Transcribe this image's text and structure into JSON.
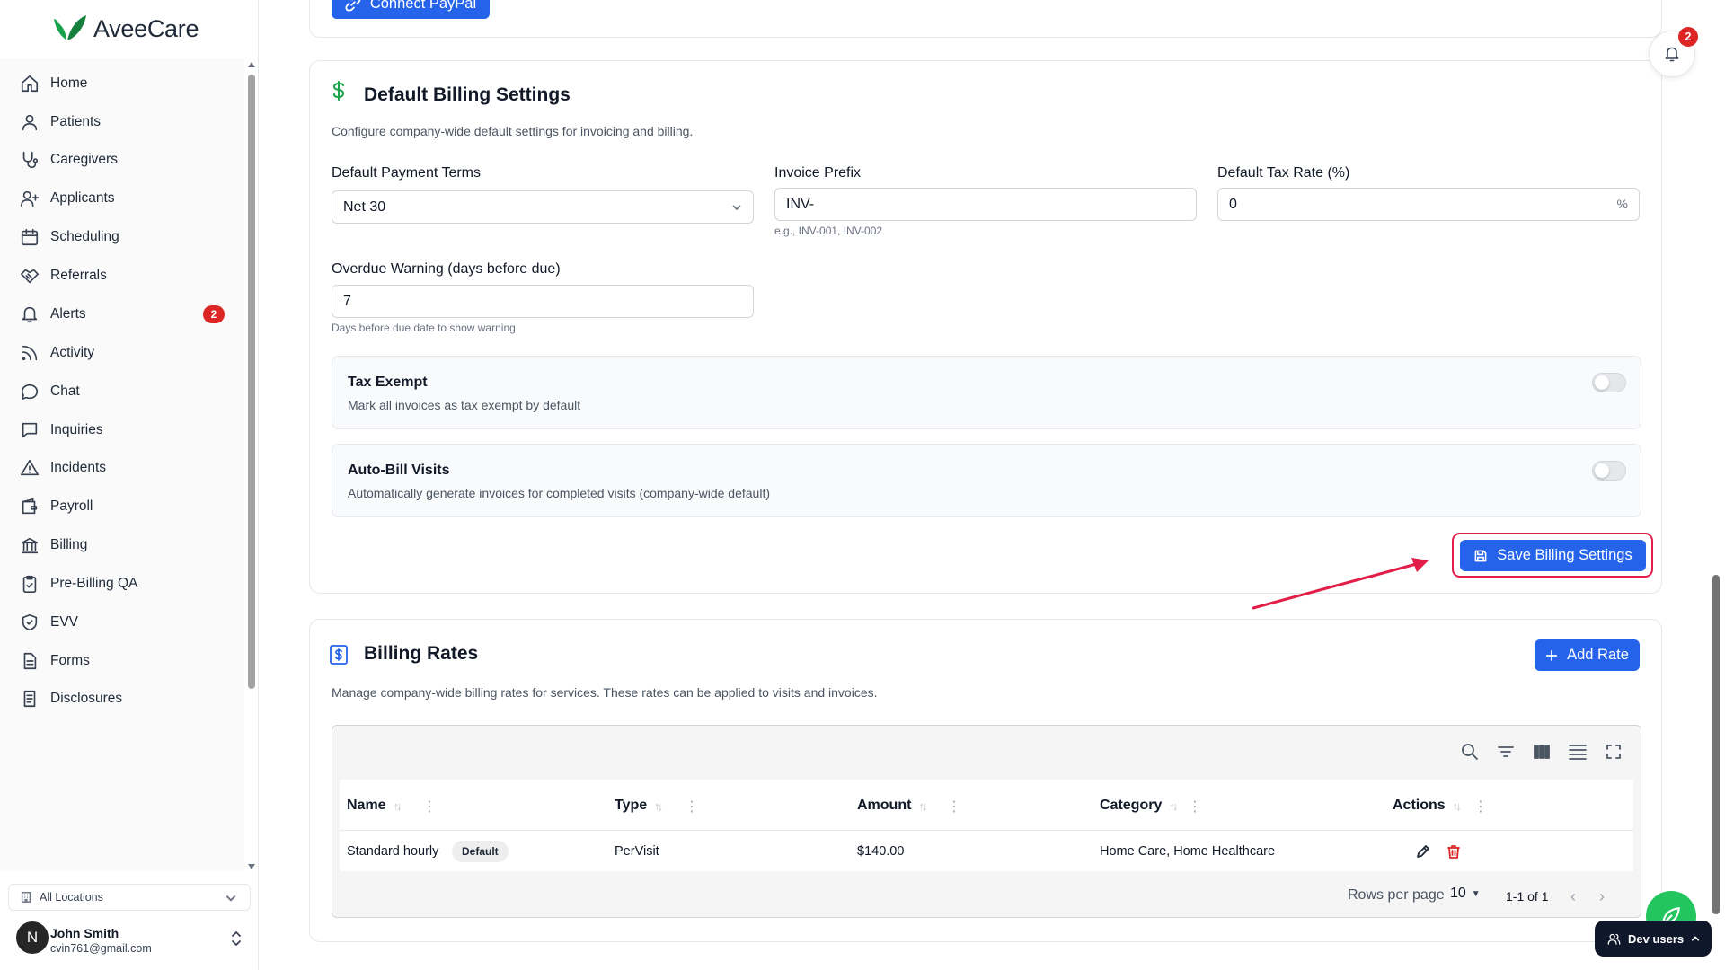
{
  "app": {
    "name": "AveeCare",
    "brand_color": "#16a34a",
    "accent_color": "#2563eb"
  },
  "sidebar": {
    "items": [
      {
        "label": "Home",
        "icon": "home-icon"
      },
      {
        "label": "Patients",
        "icon": "user-icon"
      },
      {
        "label": "Caregivers",
        "icon": "stethoscope-icon"
      },
      {
        "label": "Applicants",
        "icon": "user-plus-icon"
      },
      {
        "label": "Scheduling",
        "icon": "calendar-icon"
      },
      {
        "label": "Referrals",
        "icon": "handshake-icon"
      },
      {
        "label": "Alerts",
        "icon": "bell-icon",
        "badge": "2"
      },
      {
        "label": "Activity",
        "icon": "rss-icon"
      },
      {
        "label": "Chat",
        "icon": "message-circle-icon"
      },
      {
        "label": "Inquiries",
        "icon": "message-square-icon"
      },
      {
        "label": "Incidents",
        "icon": "warning-icon"
      },
      {
        "label": "Payroll",
        "icon": "wallet-icon"
      },
      {
        "label": "Billing",
        "icon": "bank-icon"
      },
      {
        "label": "Pre-Billing QA",
        "icon": "clipboard-check-icon"
      },
      {
        "label": "EVV",
        "icon": "shield-check-icon"
      },
      {
        "label": "Forms",
        "icon": "file-text-icon"
      },
      {
        "label": "Disclosures",
        "icon": "file-list-icon"
      }
    ],
    "location": "All Locations",
    "user": {
      "initial": "N",
      "name": "John Smith",
      "email": "cvin761@gmail.com"
    }
  },
  "top_card": {
    "paypal_button": "Connect PayPal"
  },
  "billing_settings": {
    "title": "Default Billing Settings",
    "description": "Configure company-wide default settings for invoicing and billing.",
    "payment_terms": {
      "label": "Default Payment Terms",
      "value": "Net 30"
    },
    "invoice_prefix": {
      "label": "Invoice Prefix",
      "value": "INV-",
      "hint": "e.g., INV-001, INV-002"
    },
    "tax_rate": {
      "label": "Default Tax Rate (%)",
      "value": "0",
      "suffix": "%"
    },
    "overdue_warning": {
      "label": "Overdue Warning (days before due)",
      "value": "7",
      "hint": "Days before due date to show warning"
    },
    "tax_exempt": {
      "title": "Tax Exempt",
      "description": "Mark all invoices as tax exempt by default",
      "enabled": false
    },
    "auto_bill": {
      "title": "Auto-Bill Visits",
      "description": "Automatically generate invoices for completed visits (company-wide default)",
      "enabled": false
    },
    "save_button": "Save Billing Settings"
  },
  "billing_rates": {
    "title": "Billing Rates",
    "description": "Manage company-wide billing rates for services. These rates can be applied to visits and invoices.",
    "add_button": "Add Rate",
    "columns": [
      "Name",
      "Type",
      "Amount",
      "Category",
      "Actions"
    ],
    "rows": [
      {
        "name": "Standard hourly",
        "badge": "Default",
        "type": "PerVisit",
        "amount": "$140.00",
        "category": "Home Care, Home Healthcare"
      }
    ],
    "pagination": {
      "rows_per_page_label": "Rows per page",
      "rows_per_page": "10",
      "range": "1-1 of 1"
    }
  },
  "notifications": {
    "count": "2"
  },
  "dev_users": {
    "label": "Dev users"
  }
}
